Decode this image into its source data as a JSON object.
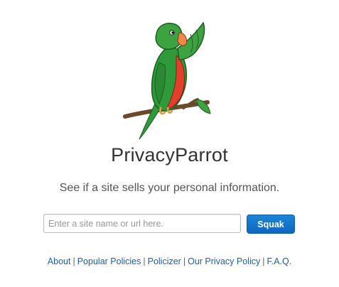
{
  "logo": {
    "icon": "parrot-logo-icon"
  },
  "title": "PrivacyParrot",
  "tagline": "See if a site sells your personal information.",
  "search": {
    "placeholder": "Enter a site name or url here.",
    "value": ""
  },
  "button_label": "Squak",
  "footer": {
    "separator": "|",
    "links": [
      "About",
      "Popular Policies",
      "Policizer",
      "Our Privacy Policy",
      "F.A.Q."
    ]
  },
  "colors": {
    "link": "#1a5fb4",
    "button": "#0e66bf",
    "parrot_green": "#2f9a3a",
    "parrot_red": "#e0402c",
    "beak": "#f0874a"
  }
}
